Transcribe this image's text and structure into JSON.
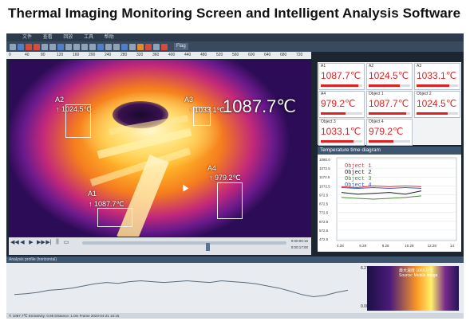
{
  "headline": "Thermal Imaging Monitoring Screen and Intelligent Analysis Software",
  "menu": {
    "items": [
      "文件",
      "查看",
      "回放",
      "工具",
      "帮助"
    ]
  },
  "toolbar": {
    "icons": [
      "prev-icon",
      "play-icon",
      "stop-icon",
      "record-icon",
      "camera-icon",
      "settings-icon",
      "zoom-icon",
      "grid-icon",
      "palette-icon",
      "export-icon"
    ],
    "flag_label": "Flag"
  },
  "ruler": {
    "ticks": [
      "0",
      "40",
      "80",
      "120",
      "160",
      "200",
      "240",
      "280",
      "320",
      "360",
      "400",
      "440",
      "480",
      "520",
      "560",
      "600",
      "640",
      "680",
      "720"
    ]
  },
  "thermal": {
    "main_readout": "1087.7℃",
    "overlays": [
      {
        "id": "A2",
        "label": "A2",
        "value": "↑ 1024.5℃"
      },
      {
        "id": "A3",
        "label": "A3",
        "value": "↑ 1033.1℃"
      },
      {
        "id": "A4",
        "label": "A4",
        "value": "↑ 979.2℃"
      },
      {
        "id": "A1",
        "label": "A1",
        "value": "↑ 1087.7℃"
      }
    ]
  },
  "playback": {
    "start_time": "0:00:00:16",
    "end_time": "0:00:17:00",
    "progress": 0.62
  },
  "readings": [
    {
      "name": "A1",
      "value": "1087.7℃",
      "level": 0.9
    },
    {
      "name": "A2",
      "value": "1024.5℃",
      "level": 0.75
    },
    {
      "name": "A3",
      "value": "1033.1℃",
      "level": 0.78
    },
    {
      "name": "A4",
      "value": "979.2℃",
      "level": 0.6
    },
    {
      "name": "Object 1",
      "value": "1087.7℃",
      "level": 0.9
    },
    {
      "name": "Object 2",
      "value": "1024.5℃",
      "level": 0.75
    },
    {
      "name": "Object 3",
      "value": "1033.1℃",
      "level": 0.78
    },
    {
      "name": "Object 4",
      "value": "979.2℃",
      "level": 0.6
    }
  ],
  "trend": {
    "title": "Temperature time diagram",
    "y_ticks": [
      "1080.0",
      "1072.5",
      "1172.5",
      "1072.5",
      "972.5",
      "872.5",
      "772.5",
      "672.5",
      "572.5",
      "472.5"
    ],
    "x_ticks": [
      "4.28",
      "6.28",
      "8.28",
      "10.28",
      "12.28",
      "14"
    ],
    "legend": [
      {
        "name": "Object 1",
        "color": "#d83a3a"
      },
      {
        "name": "Object 2",
        "color": "#222222"
      },
      {
        "name": "Object 3",
        "color": "#4a8a3a"
      },
      {
        "name": "Object 4",
        "color": "#3a5ad8"
      }
    ],
    "series_levels": [
      {
        "color": "#d83a3a",
        "values": [
          0.35,
          0.36,
          0.34,
          0.35,
          0.34,
          0.35
        ]
      },
      {
        "color": "#222222",
        "values": [
          0.42,
          0.44,
          0.43,
          0.42,
          0.44,
          0.4
        ]
      },
      {
        "color": "#4a8a3a",
        "values": [
          0.48,
          0.49,
          0.5,
          0.49,
          0.48,
          0.46
        ]
      },
      {
        "color": "#3a5ad8",
        "values": [
          0.36,
          0.37,
          0.36,
          0.37,
          0.36,
          0.37
        ]
      }
    ]
  },
  "profile": {
    "title": "Analysis profile (horizontal)",
    "levels": [
      0.3,
      0.32,
      0.35,
      0.4,
      0.42,
      0.45,
      0.5,
      0.55,
      0.58,
      0.56,
      0.6,
      0.62,
      0.6,
      0.58,
      0.6,
      0.62,
      0.6,
      0.58,
      0.62,
      0.6,
      0.58,
      0.55,
      0.5,
      0.45,
      0.38,
      0.3,
      0.25,
      0.28,
      0.35,
      0.4
    ],
    "scale_top": "6.27",
    "scale_bottom": "0.00",
    "thumb_caption": "最大温度 1060.0 ℃",
    "thumb_source": "Source: Mobile image"
  },
  "statusbar": {
    "text": "T: 1087.7℃   Emissivity: 0.95   Distance: 1.0m   Frame 2023-04-21 10:15"
  }
}
